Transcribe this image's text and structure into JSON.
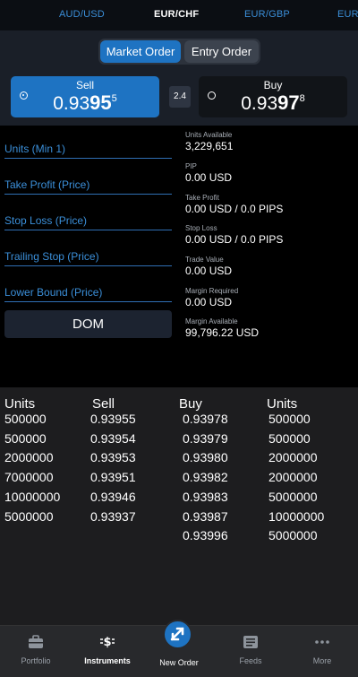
{
  "pairs": [
    {
      "label": "AUD/USD",
      "active": false
    },
    {
      "label": "EUR/CHF",
      "active": true
    },
    {
      "label": "EUR/GBP",
      "active": false
    },
    {
      "label": "EUR",
      "active": false
    }
  ],
  "order_type": {
    "market": "Market Order",
    "entry": "Entry Order",
    "selected": "Market Order"
  },
  "sell": {
    "label": "Sell",
    "price_prefix": "0.93",
    "price_big": "95",
    "price_pip": "5"
  },
  "buy": {
    "label": "Buy",
    "price_prefix": "0.93",
    "price_big": "97",
    "price_pip": "8"
  },
  "spread": "2.4",
  "fields": {
    "units": "Units (Min 1)",
    "take_profit": "Take Profit (Price)",
    "stop_loss": "Stop Loss (Price)",
    "trailing_stop": "Trailing Stop (Price)",
    "lower_bound": "Lower Bound (Price)"
  },
  "dom_button": "DOM",
  "info": {
    "units_available_label": "Units Available",
    "units_available": "3,229,651",
    "pip_label": "PIP",
    "pip": "0.00 USD",
    "take_profit_label": "Take Profit",
    "take_profit": "0.00 USD / 0.0 PIPS",
    "stop_loss_label": "Stop Loss",
    "stop_loss": "0.00 USD / 0.0 PIPS",
    "trade_value_label": "Trade Value",
    "trade_value": "0.00 USD",
    "margin_required_label": "Margin Required",
    "margin_required": "0.00 USD",
    "margin_available_label": "Margin Available",
    "margin_available": "99,796.22 USD"
  },
  "depth": {
    "headers": {
      "units_sell": "Units",
      "sell": "Sell",
      "buy": "Buy",
      "units_buy": "Units"
    },
    "sell_units": [
      "500000",
      "500000",
      "2000000",
      "7000000",
      "10000000",
      "5000000"
    ],
    "sell_prices": [
      "0.93955",
      "0.93954",
      "0.93953",
      "0.93951",
      "0.93946",
      "0.93937"
    ],
    "buy_prices": [
      "0.93978",
      "0.93979",
      "0.93980",
      "0.93982",
      "0.93983",
      "0.93987",
      "0.93996"
    ],
    "buy_units": [
      "500000",
      "500000",
      "2000000",
      "2000000",
      "5000000",
      "10000000",
      "5000000"
    ]
  },
  "nav": {
    "portfolio": "Portfolio",
    "instruments": "Instruments",
    "new_order": "New Order",
    "feeds": "Feeds",
    "more": "More"
  },
  "colors": {
    "accent": "#1e73c2",
    "link": "#3b8fd9"
  }
}
